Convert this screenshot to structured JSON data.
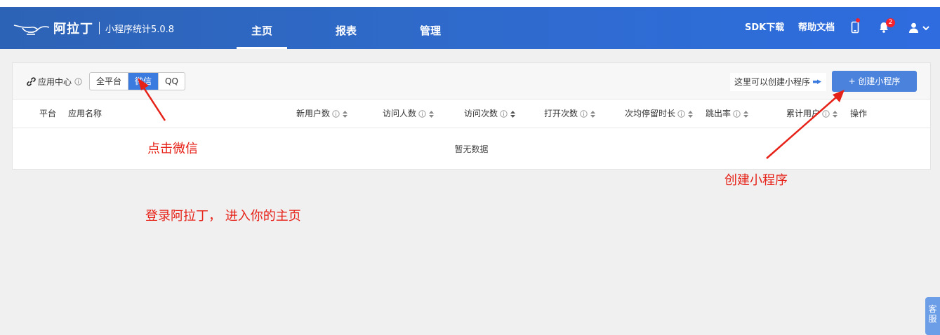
{
  "brand": {
    "name": "阿拉丁",
    "subtitle": "小程序统计5.0.8"
  },
  "nav": {
    "tabs": [
      {
        "label": "主页",
        "active": true
      },
      {
        "label": "报表",
        "active": false
      },
      {
        "label": "管理",
        "active": false
      }
    ],
    "sdk_label": "SDK下载",
    "docs_label": "帮助文档",
    "notification_count": "2"
  },
  "toolbar": {
    "app_center_label": "应用中心",
    "platform_filters": [
      {
        "label": "全平台",
        "active": false
      },
      {
        "label": "微信",
        "active": true
      },
      {
        "label": "QQ",
        "active": false
      }
    ],
    "hint_text": "这里可以创建小程序",
    "create_button": "+ 创建小程序"
  },
  "table": {
    "columns": [
      {
        "label": "平台",
        "info": false,
        "sortable": false
      },
      {
        "label": "应用名称",
        "info": false,
        "sortable": false
      },
      {
        "label": "新用户数",
        "info": true,
        "sortable": true
      },
      {
        "label": "访问人数",
        "info": true,
        "sortable": true
      },
      {
        "label": "访问次数",
        "info": true,
        "sortable": true
      },
      {
        "label": "打开次数",
        "info": true,
        "sortable": true
      },
      {
        "label": "次均停留时长",
        "info": true,
        "sortable": true
      },
      {
        "label": "跳出率",
        "info": true,
        "sortable": true
      },
      {
        "label": "累计用户",
        "info": true,
        "sortable": true
      },
      {
        "label": "操作",
        "info": false,
        "sortable": false
      }
    ],
    "empty_text": "暂无数据"
  },
  "annotations": {
    "click_wechat": "点击微信",
    "create_miniprogram": "创建小程序",
    "login_note": "登录阿拉丁， 进入你的主页"
  },
  "service": {
    "label_line1": "客",
    "label_line2": "服"
  },
  "colors": {
    "nav_start": "#2d63b6",
    "nav_end": "#2e6ce0",
    "accent": "#3b7be0",
    "annotation_red": "#e62117",
    "badge_red": "#f5222d"
  }
}
